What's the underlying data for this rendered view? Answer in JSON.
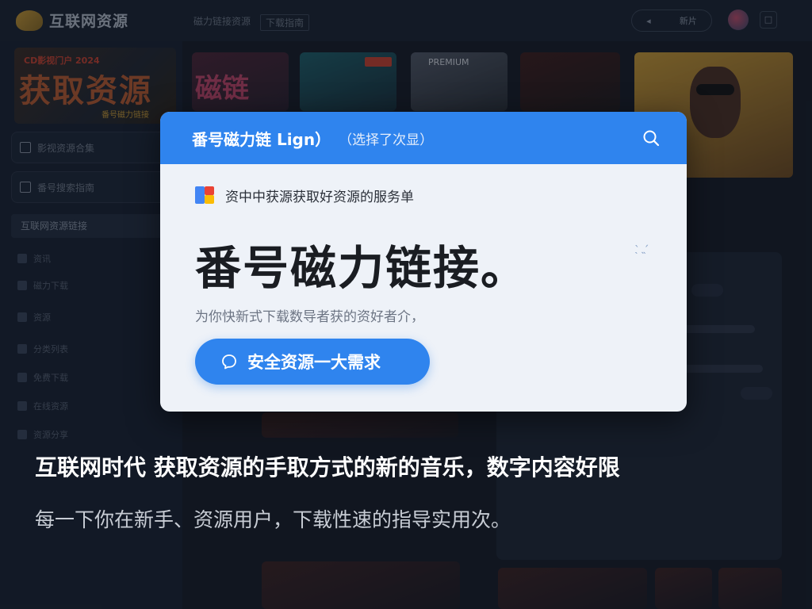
{
  "topbar": {
    "logo_text": "互联网资源",
    "crumb_1": "磁力链接资源",
    "crumb_2": "下载指南",
    "pill_left": "◂",
    "pill_right": "新片",
    "icon_label": "□"
  },
  "sidebar": {
    "banner_small": "CD影视门户 2024",
    "banner_big": "获取资源",
    "banner_foot": "番号磁力链接",
    "item_1": "影视资源合集",
    "item_2": "番号搜索指南",
    "active_item": "互联网资源链接",
    "rows": [
      "资讯",
      "磁力下载",
      "资源",
      "分类列表",
      "免费下载",
      "在线资源",
      "资源分享"
    ]
  },
  "tiles": {
    "t1_label": "磁链",
    "t3_label": "PREMIUM"
  },
  "modal": {
    "title": "番号磁力链 Lign）",
    "subtitle": "（选择了次显）",
    "source_text": "资中中获源获取好资源的服务单",
    "headline": "番号磁力链接。",
    "description": "为你快新式下载数导者获的资好者介，",
    "cta_label": "安全资源一大需求",
    "colors": {
      "header": "#2f84ee",
      "cta": "#2f84ee"
    }
  },
  "caption": {
    "line_1": "互联网时代   获取资源的手取方式的新的音乐，数字内容好限",
    "line_2": "每一下你在新手、资源用户，下载性速的指导实用次。"
  },
  "icons": [
    "search-icon",
    "chat-bubble-icon",
    "google-icon",
    "sparkle-icon",
    "avatar",
    "logo-icon"
  ]
}
